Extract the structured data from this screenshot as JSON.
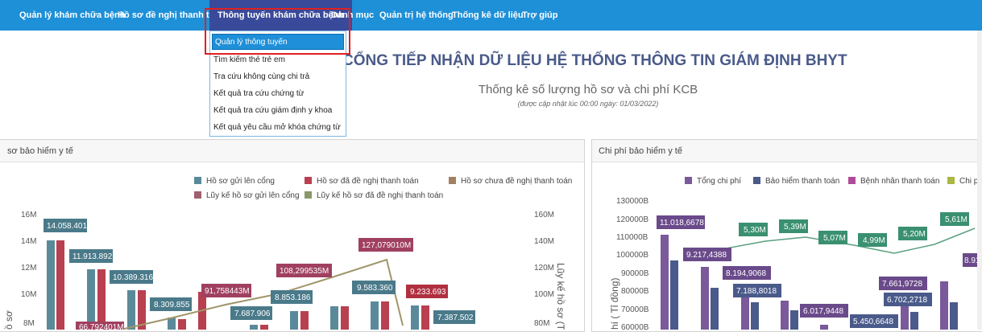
{
  "nav": {
    "items": [
      "Quản lý khám chữa bệnh",
      "Hồ sơ đề nghị thanh toán",
      "Thông tuyến khám chữa bệnh",
      "Danh mục",
      "Quản trị hệ thống",
      "Thống kê dữ liệu",
      "Trợ giúp"
    ],
    "active_index": 2
  },
  "dropdown": {
    "items": [
      "Quản lý thông tuyến",
      "Tìm kiếm thẻ trẻ em",
      "Tra cứu không cùng chi trả",
      "Kết quả tra cứu chứng từ",
      "Kết quả tra cứu giám định y khoa",
      "Kết quả yêu cầu mở khóa chứng từ"
    ],
    "active_index": 0
  },
  "header": {
    "title": "CỔNG TIẾP NHẬN DỮ LIỆU HỆ THỐNG THÔNG TIN GIÁM ĐỊNH BHYT",
    "subtitle": "Thống kê số lượng hồ sơ và chi phí KCB",
    "note": "(được cập nhật lúc 00:00 ngày: 01/03/2022)"
  },
  "colors": {
    "nav_bg": "#1e90d8",
    "nav_active": "#3a4a9a",
    "highlight_box": "#e02020"
  },
  "left_panel": {
    "title": "sơ bảo hiểm y tế",
    "legend": [
      {
        "label": "Hồ sơ gửi lên cổng",
        "color": "#5a8a9a"
      },
      {
        "label": "Hồ sơ đã đề nghị thanh toán",
        "color": "#b84050"
      },
      {
        "label": "Hồ sơ chưa đề nghị thanh toán",
        "color": "#a08060"
      },
      {
        "label": "Lũy kế hồ sơ gửi lên cổng",
        "color": "#a06070"
      },
      {
        "label": "Lũy kế hồ sơ đã đề nghị thanh toán",
        "color": "#889868"
      }
    ],
    "y_left_ticks": [
      "16M",
      "14M",
      "12M",
      "10M",
      "8M"
    ],
    "y_right_ticks": [
      "160M",
      "140M",
      "120M",
      "100M",
      "80M"
    ],
    "y_right_label": "Lũy kế hồ sơ (T"
  },
  "right_panel": {
    "title": "Chi phí bảo hiểm y tế",
    "legend": [
      {
        "label": "Tổng chi phí",
        "color": "#7a5a9a"
      },
      {
        "label": "Bảo hiểm thanh toán",
        "color": "#4a5a8a"
      },
      {
        "label": "Bệnh nhân thanh toán",
        "color": "#b04a9a"
      },
      {
        "label": "Chi p",
        "color": "#a8b840"
      }
    ],
    "y_ticks": [
      "130000B",
      "120000B",
      "110000B",
      "100000B",
      "90000B",
      "80000B",
      "70000B",
      "60000B"
    ],
    "y_label": "hí ( Tỉ đồng)"
  },
  "chart_data": [
    {
      "type": "bar",
      "title": "",
      "ylim": [
        7000000,
        16000000
      ],
      "y2lim": [
        70000000,
        160000000
      ],
      "series": [
        {
          "name": "Hồ sơ gửi lên cổng",
          "values": [
            14058401,
            11913892,
            10389316,
            8309855,
            null,
            7687906,
            8853186,
            null,
            9583360,
            7387502
          ]
        },
        {
          "name": "Hồ sơ đã đề nghị thanh toán",
          "values": [
            14000000,
            11900000,
            10389316,
            8309855,
            null,
            7600000,
            8853186,
            9200000,
            9583360,
            9233693
          ]
        },
        {
          "name": "Lũy kế hồ sơ đã đề nghị thanh toán",
          "axis": "right",
          "values": [
            null,
            null,
            null,
            72000000,
            82000000,
            91758443,
            108299535,
            127079010,
            60000000,
            null
          ]
        }
      ],
      "labels": [
        "14.058.401",
        "11.913.892",
        "10.389.316",
        "8.309.855",
        "7.687.906",
        "8.853.186",
        "9.583.360",
        "9.233.693",
        "7.387.502",
        "91,758443M",
        "108,299535M",
        "127,079010M",
        "66,792401M"
      ]
    },
    {
      "type": "bar",
      "title": "",
      "ylim": [
        60000,
        130000
      ],
      "series": [
        {
          "name": "Tổng chi phí",
          "values": [
            110186.678,
            92174.388,
            81949.068,
            71888.018,
            60179.448,
            54506.648,
            76619.728,
            67027.218,
            89100
          ]
        },
        {
          "name": "Chi p",
          "line": true,
          "values": [
            5.3,
            5.39,
            5.07,
            4.99,
            5.2,
            5.61
          ]
        }
      ],
      "labels": [
        "11.018,6678",
        "9.217,4388",
        "8.194,9068",
        "7.188,8018",
        "6.017,9448",
        "5.450,6648",
        "7.661,9728",
        "6.702,2718",
        "8.91",
        "5,30M",
        "5,39M",
        "5,07M",
        "4,99M",
        "5,20M",
        "5,61M"
      ]
    }
  ]
}
